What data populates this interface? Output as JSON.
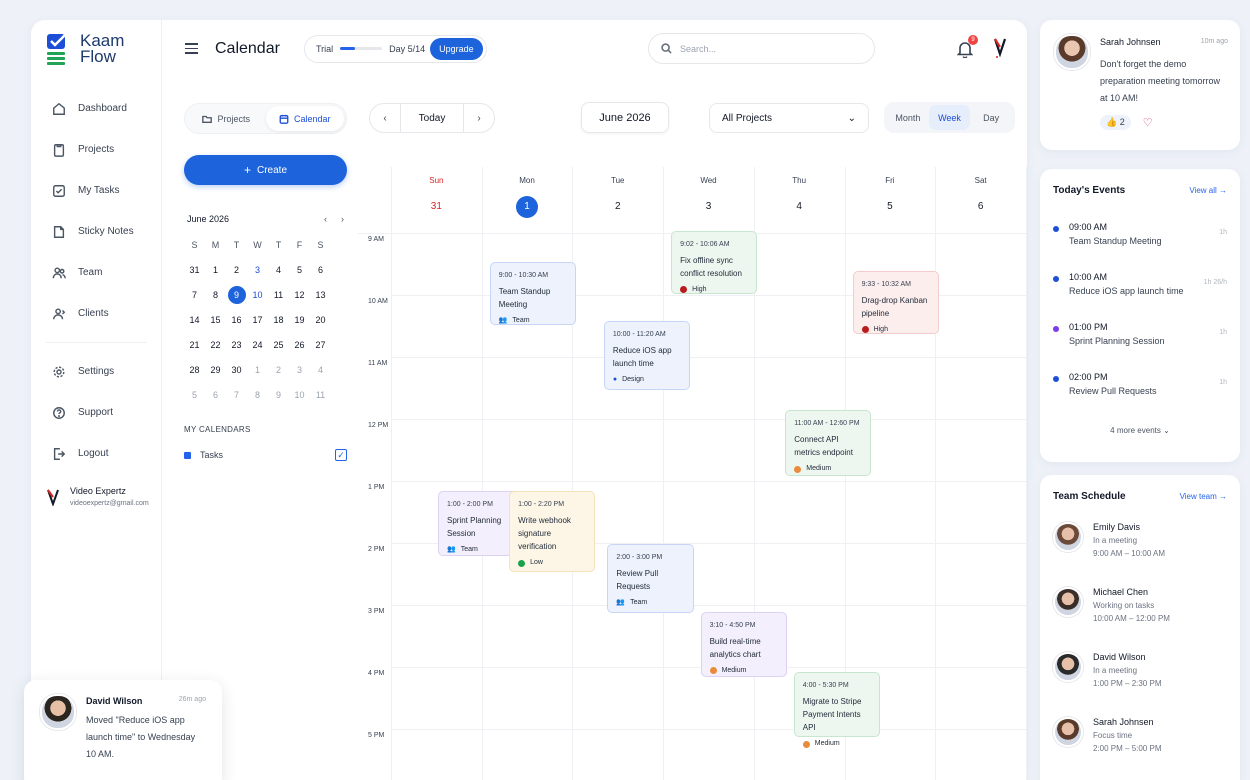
{
  "app": {
    "name_line1": "Kaam",
    "name_line2": "Flow"
  },
  "nav": [
    {
      "label": "Dashboard",
      "icon": "home-icon"
    },
    {
      "label": "Projects",
      "icon": "clipboard-icon"
    },
    {
      "label": "My Tasks",
      "icon": "checkbox-icon"
    },
    {
      "label": "Sticky Notes",
      "icon": "note-icon"
    },
    {
      "label": "Team",
      "icon": "team-icon"
    },
    {
      "label": "Clients",
      "icon": "clients-icon"
    }
  ],
  "nav_bottom": [
    {
      "label": "Settings",
      "icon": "gear-icon"
    },
    {
      "label": "Support",
      "icon": "support-icon"
    },
    {
      "label": "Logout",
      "icon": "logout-icon"
    }
  ],
  "user": {
    "name": "Video Expertz",
    "email": "videoexpertz@gmail.com"
  },
  "topbar": {
    "title": "Calendar",
    "trial_label": "Trial",
    "trial_progress": 0.36,
    "trial_day": "Day 5/14",
    "upgrade": "Upgrade",
    "search_placeholder": "Search...",
    "notif_count": "9"
  },
  "left": {
    "toggle_projects": "Projects",
    "toggle_calendar": "Calendar",
    "create": "Create",
    "mini_month": "June 2026",
    "weekdays": [
      "S",
      "M",
      "T",
      "W",
      "T",
      "F",
      "S"
    ],
    "mini_days": [
      {
        "d": "31",
        "k": ""
      },
      {
        "d": "1",
        "k": ""
      },
      {
        "d": "2",
        "k": ""
      },
      {
        "d": "3",
        "k": "blue"
      },
      {
        "d": "4",
        "k": ""
      },
      {
        "d": "5",
        "k": ""
      },
      {
        "d": "6",
        "k": ""
      },
      {
        "d": "7",
        "k": ""
      },
      {
        "d": "8",
        "k": ""
      },
      {
        "d": "9",
        "k": "today"
      },
      {
        "d": "10",
        "k": "blue"
      },
      {
        "d": "11",
        "k": ""
      },
      {
        "d": "12",
        "k": ""
      },
      {
        "d": "13",
        "k": ""
      },
      {
        "d": "14",
        "k": ""
      },
      {
        "d": "15",
        "k": ""
      },
      {
        "d": "16",
        "k": ""
      },
      {
        "d": "17",
        "k": ""
      },
      {
        "d": "18",
        "k": ""
      },
      {
        "d": "19",
        "k": ""
      },
      {
        "d": "20",
        "k": ""
      },
      {
        "d": "21",
        "k": ""
      },
      {
        "d": "22",
        "k": ""
      },
      {
        "d": "23",
        "k": ""
      },
      {
        "d": "24",
        "k": ""
      },
      {
        "d": "25",
        "k": ""
      },
      {
        "d": "26",
        "k": ""
      },
      {
        "d": "27",
        "k": ""
      },
      {
        "d": "28",
        "k": ""
      },
      {
        "d": "29",
        "k": ""
      },
      {
        "d": "30",
        "k": ""
      },
      {
        "d": "1",
        "k": "muted"
      },
      {
        "d": "2",
        "k": "muted"
      },
      {
        "d": "3",
        "k": "muted"
      },
      {
        "d": "4",
        "k": "muted"
      },
      {
        "d": "5",
        "k": "muted"
      },
      {
        "d": "6",
        "k": "muted"
      },
      {
        "d": "7",
        "k": "muted"
      },
      {
        "d": "8",
        "k": "muted"
      },
      {
        "d": "9",
        "k": "muted"
      },
      {
        "d": "10",
        "k": "muted"
      },
      {
        "d": "11",
        "k": "muted"
      }
    ],
    "my_calendars": "MY CALENDARS",
    "calendar_item": "Tasks",
    "calendar_color": "#2563eb"
  },
  "controls": {
    "today": "Today",
    "month_label": "June 2026",
    "project_filter": "All Projects",
    "views": [
      "Month",
      "Week",
      "Day"
    ],
    "active_view": "Week"
  },
  "week": {
    "days": [
      {
        "name": "Sun",
        "date": "31",
        "kind": "sun"
      },
      {
        "name": "Mon",
        "date": "1",
        "kind": "cur"
      },
      {
        "name": "Tue",
        "date": "2",
        "kind": ""
      },
      {
        "name": "Wed",
        "date": "3",
        "kind": ""
      },
      {
        "name": "Thu",
        "date": "4",
        "kind": ""
      },
      {
        "name": "Fri",
        "date": "5",
        "kind": ""
      },
      {
        "name": "Sat",
        "date": "6",
        "kind": ""
      }
    ],
    "hours": [
      "9 AM",
      "10 AM",
      "11 AM",
      "12 PM",
      "1 PM",
      "2 PM",
      "3 PM",
      "4 PM",
      "5 PM"
    ]
  },
  "events": [
    {
      "time": "9:00 - 10:30 AM",
      "title": "Team Standup Meeting",
      "tag": "Team",
      "tag_icon": "team-icon",
      "color": "blue"
    },
    {
      "time": "9:02 - 10:06 AM",
      "title": "Fix offline sync conflict resolution",
      "tag": "High",
      "tag_color": "#b91c1c",
      "color": "green"
    },
    {
      "time": "9:33 - 10:32 AM",
      "title": "Drag-drop Kanban pipeline",
      "tag": "High",
      "tag_color": "#b91c1c",
      "color": "red"
    },
    {
      "time": "10:00 - 11:20 AM",
      "title": "Reduce iOS app launch time",
      "tag": "Design",
      "tag_icon": "design-icon",
      "color": "blue"
    },
    {
      "time": "11:00 AM - 12:60 PM",
      "title": "Connect API metrics endpoint",
      "tag": "Medium",
      "tag_color": "#ea8a3b",
      "color": "green"
    },
    {
      "time": "1:00 - 2:00 PM",
      "title": "Sprint Planning Session",
      "tag": "Team",
      "tag_icon": "team-icon",
      "color": "purple"
    },
    {
      "time": "1:00 - 2:20 PM",
      "title": "Write webhook signature verification",
      "tag": "Low",
      "tag_color": "#16a34a",
      "color": "yellow"
    },
    {
      "time": "2:00 - 3:00 PM",
      "title": "Review Pull Requests",
      "tag": "Team",
      "tag_icon": "team-icon",
      "color": "blue"
    },
    {
      "time": "3:10 - 4:50 PM",
      "title": "Build real-time analytics chart",
      "tag": "Medium",
      "tag_color": "#ea8a3b",
      "color": "purple"
    },
    {
      "time": "4:00 - 5:30 PM",
      "title": "Migrate to Stripe Payment Intents API",
      "tag": "Medium",
      "tag_color": "#ea8a3b",
      "color": "green"
    }
  ],
  "notification": {
    "name": "Sarah Johnsen",
    "ago": "10m ago",
    "message": "Don't forget the demo preparation meeting tomorrow at 10 AM!",
    "likes": "2"
  },
  "today_events": {
    "title": "Today's Events",
    "view_all": "View all →",
    "items": [
      {
        "time": "09:00 AM",
        "title": "Team Standup Meeting",
        "dur": "1h",
        "color": "#1d4ed8"
      },
      {
        "time": "10:00 AM",
        "title": "Reduce iOS app launch time",
        "dur": "1h 26/h",
        "color": "#1d4ed8"
      },
      {
        "time": "01:00 PM",
        "title": "Sprint Planning Session",
        "dur": "1h",
        "color": "#7c3aed"
      },
      {
        "time": "02:00 PM",
        "title": "Review Pull Requests",
        "dur": "1h",
        "color": "#1d4ed8"
      }
    ],
    "more": "4 more events"
  },
  "team_schedule": {
    "title": "Team Schedule",
    "view_team": "View team →",
    "members": [
      {
        "name": "Emily Davis",
        "status": "In a meeting",
        "hours": "9:00 AM – 10:00 AM"
      },
      {
        "name": "Michael Chen",
        "status": "Working on tasks",
        "hours": "10:00 AM – 12:00 PM"
      },
      {
        "name": "David Wilson",
        "status": "In a meeting",
        "hours": "1:00 PM – 2:30 PM"
      },
      {
        "name": "Sarah Johnsen",
        "status": "Focus time",
        "hours": "2:00 PM – 5:00 PM"
      }
    ]
  },
  "toast": {
    "name": "David Wilson",
    "ago": "26m ago",
    "message": "Moved \"Reduce iOS app launch time\" to Wednesday 10 AM."
  }
}
